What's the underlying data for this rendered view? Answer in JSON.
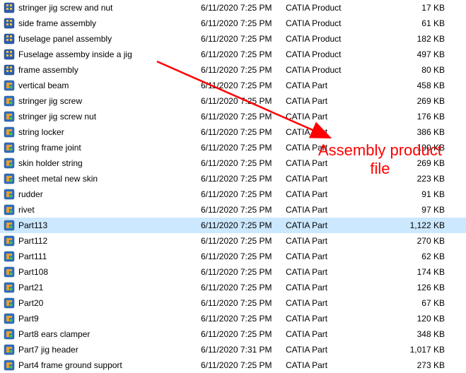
{
  "annotation": {
    "line1": "Assembly product",
    "line2": "file"
  },
  "files": [
    {
      "name": "stringer jig screw and nut",
      "date": "6/11/2020 7:25 PM",
      "type": "CATIA Product",
      "size": "17 KB",
      "selected": false,
      "icon": "product"
    },
    {
      "name": "side frame assembly",
      "date": "6/11/2020 7:25 PM",
      "type": "CATIA Product",
      "size": "61 KB",
      "selected": false,
      "icon": "product"
    },
    {
      "name": "fuselage panel assembly",
      "date": "6/11/2020 7:25 PM",
      "type": "CATIA Product",
      "size": "182 KB",
      "selected": false,
      "icon": "product"
    },
    {
      "name": "Fuselage assemby inside a jig",
      "date": "6/11/2020 7:25 PM",
      "type": "CATIA Product",
      "size": "497 KB",
      "selected": false,
      "icon": "product"
    },
    {
      "name": "frame assembly",
      "date": "6/11/2020 7:25 PM",
      "type": "CATIA Product",
      "size": "80 KB",
      "selected": false,
      "icon": "product"
    },
    {
      "name": "vertical beam",
      "date": "6/11/2020 7:25 PM",
      "type": "CATIA Part",
      "size": "458 KB",
      "selected": false,
      "icon": "part"
    },
    {
      "name": "stringer jig screw",
      "date": "6/11/2020 7:25 PM",
      "type": "CATIA Part",
      "size": "269 KB",
      "selected": false,
      "icon": "part"
    },
    {
      "name": "stringer jig screw nut",
      "date": "6/11/2020 7:25 PM",
      "type": "CATIA Part",
      "size": "176 KB",
      "selected": false,
      "icon": "part"
    },
    {
      "name": "string locker",
      "date": "6/11/2020 7:25 PM",
      "type": "CATIA Part",
      "size": "386 KB",
      "selected": false,
      "icon": "part"
    },
    {
      "name": "string frame joint",
      "date": "6/11/2020 7:25 PM",
      "type": "CATIA Part",
      "size": "190 KB",
      "selected": false,
      "icon": "part"
    },
    {
      "name": "skin holder string",
      "date": "6/11/2020 7:25 PM",
      "type": "CATIA Part",
      "size": "269 KB",
      "selected": false,
      "icon": "part"
    },
    {
      "name": "sheet metal new skin",
      "date": "6/11/2020 7:25 PM",
      "type": "CATIA Part",
      "size": "223 KB",
      "selected": false,
      "icon": "part"
    },
    {
      "name": "rudder",
      "date": "6/11/2020 7:25 PM",
      "type": "CATIA Part",
      "size": "91 KB",
      "selected": false,
      "icon": "part"
    },
    {
      "name": "rivet",
      "date": "6/11/2020 7:25 PM",
      "type": "CATIA Part",
      "size": "97 KB",
      "selected": false,
      "icon": "part"
    },
    {
      "name": "Part113",
      "date": "6/11/2020 7:25 PM",
      "type": "CATIA Part",
      "size": "1,122 KB",
      "selected": true,
      "icon": "part"
    },
    {
      "name": "Part112",
      "date": "6/11/2020 7:25 PM",
      "type": "CATIA Part",
      "size": "270 KB",
      "selected": false,
      "icon": "part"
    },
    {
      "name": "Part111",
      "date": "6/11/2020 7:25 PM",
      "type": "CATIA Part",
      "size": "62 KB",
      "selected": false,
      "icon": "part"
    },
    {
      "name": "Part108",
      "date": "6/11/2020 7:25 PM",
      "type": "CATIA Part",
      "size": "174 KB",
      "selected": false,
      "icon": "part"
    },
    {
      "name": "Part21",
      "date": "6/11/2020 7:25 PM",
      "type": "CATIA Part",
      "size": "126 KB",
      "selected": false,
      "icon": "part"
    },
    {
      "name": "Part20",
      "date": "6/11/2020 7:25 PM",
      "type": "CATIA Part",
      "size": "67 KB",
      "selected": false,
      "icon": "part"
    },
    {
      "name": "Part9",
      "date": "6/11/2020 7:25 PM",
      "type": "CATIA Part",
      "size": "120 KB",
      "selected": false,
      "icon": "part"
    },
    {
      "name": "Part8 ears clamper",
      "date": "6/11/2020 7:25 PM",
      "type": "CATIA Part",
      "size": "348 KB",
      "selected": false,
      "icon": "part"
    },
    {
      "name": "Part7 jig header",
      "date": "6/11/2020 7:31 PM",
      "type": "CATIA Part",
      "size": "1,017 KB",
      "selected": false,
      "icon": "part"
    },
    {
      "name": "Part4 frame ground support",
      "date": "6/11/2020 7:25 PM",
      "type": "CATIA Part",
      "size": "273 KB",
      "selected": false,
      "icon": "part"
    }
  ]
}
